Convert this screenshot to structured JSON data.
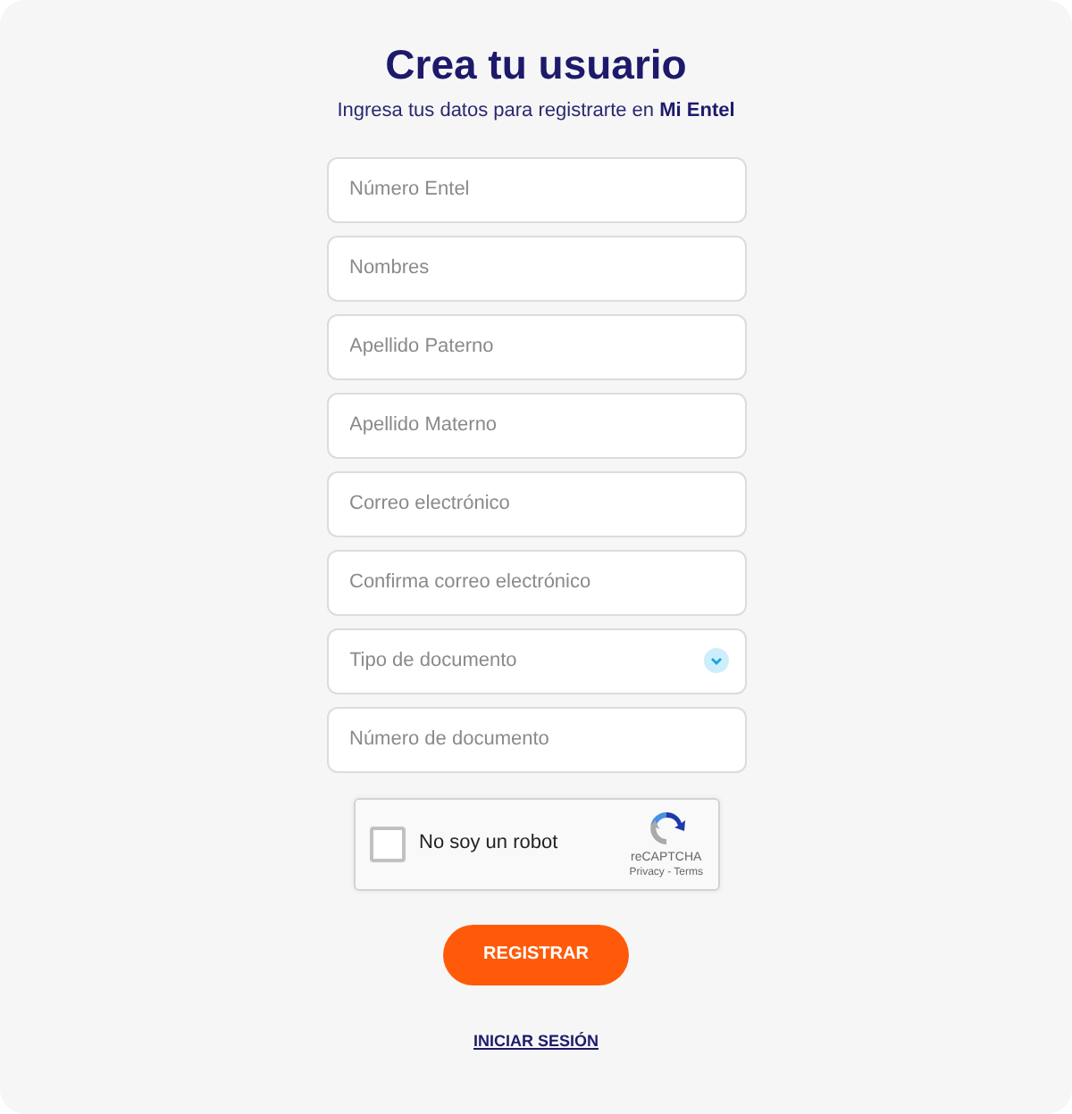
{
  "header": {
    "title": "Crea tu usuario",
    "subtitle": "Ingresa tus datos para registrarte en **Mi Entel**"
  },
  "fields": [
    {
      "kind": "text",
      "placeholder": "Número Entel"
    },
    {
      "kind": "text",
      "placeholder": "Nombres"
    },
    {
      "kind": "text",
      "placeholder": "Apellido Paterno"
    },
    {
      "kind": "text",
      "placeholder": "Apellido Materno"
    },
    {
      "kind": "text",
      "placeholder": "Correo electrónico"
    },
    {
      "kind": "text",
      "placeholder": "Confirma correo electrónico"
    },
    {
      "kind": "select",
      "placeholder": "Tipo de documento"
    },
    {
      "kind": "text",
      "placeholder": "Número de documento"
    }
  ],
  "captcha": {
    "label": "No soy un robot",
    "checked": false,
    "brand": "reCAPTCHA",
    "links": "Privacy - Terms"
  },
  "submit_button": "REGISTRAR",
  "login_link": "INICIAR SESIÓN"
}
